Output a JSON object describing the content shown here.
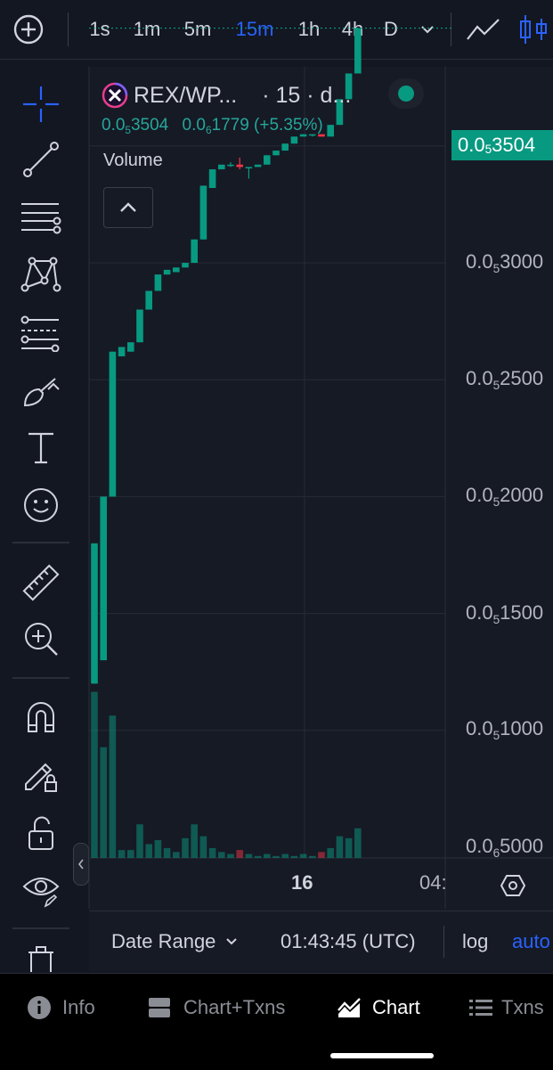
{
  "topbar": {
    "intervals": [
      "1s",
      "1m",
      "5m",
      "15m",
      "1h",
      "4h",
      "D"
    ],
    "active_interval": "15m",
    "active_color": "#2962ff"
  },
  "legend": {
    "symbol": "REX/WP...",
    "resolution": "· 15 · d...",
    "status_color": "#089981",
    "ohlc_values": [
      {
        "lead": "0.0",
        "sub": "5",
        "rest": "3504"
      },
      {
        "lead": "0.0",
        "sub": "6",
        "rest": "1779 (+5.35%)"
      }
    ],
    "volume_label": "Volume"
  },
  "chart_data": {
    "type": "candlestick",
    "interval": "15m",
    "price_axis_ticks": [
      {
        "lead": "0.0",
        "sub": "5",
        "rest": "3000"
      },
      {
        "lead": "0.0",
        "sub": "5",
        "rest": "2500"
      },
      {
        "lead": "0.0",
        "sub": "5",
        "rest": "2000"
      },
      {
        "lead": "0.0",
        "sub": "5",
        "rest": "1500"
      },
      {
        "lead": "0.0",
        "sub": "5",
        "rest": "1000"
      },
      {
        "lead": "0.0",
        "sub": "6",
        "rest": "5000"
      }
    ],
    "last_price": {
      "lead": "0.0",
      "sub": "5",
      "rest": "3504"
    },
    "time_axis_ticks": [
      "16",
      "04:"
    ],
    "up_color": "#089981",
    "down_color": "#f23645",
    "candles_units": "price ×1e-6",
    "candles": [
      {
        "o": 0.7,
        "h": 1.3,
        "l": 0.7,
        "c": 1.3
      },
      {
        "o": 0.8,
        "h": 1.5,
        "l": 0.8,
        "c": 1.5
      },
      {
        "o": 1.5,
        "h": 2.12,
        "l": 1.5,
        "c": 2.12
      },
      {
        "o": 2.1,
        "h": 2.14,
        "l": 2.1,
        "c": 2.14
      },
      {
        "o": 2.12,
        "h": 2.16,
        "l": 2.12,
        "c": 2.16
      },
      {
        "o": 2.16,
        "h": 2.3,
        "l": 2.16,
        "c": 2.3
      },
      {
        "o": 2.3,
        "h": 2.38,
        "l": 2.3,
        "c": 2.38
      },
      {
        "o": 2.38,
        "h": 2.45,
        "l": 2.38,
        "c": 2.45
      },
      {
        "o": 2.45,
        "h": 2.47,
        "l": 2.45,
        "c": 2.47
      },
      {
        "o": 2.46,
        "h": 2.48,
        "l": 2.46,
        "c": 2.48
      },
      {
        "o": 2.48,
        "h": 2.5,
        "l": 2.48,
        "c": 2.5
      },
      {
        "o": 2.5,
        "h": 2.6,
        "l": 2.5,
        "c": 2.6
      },
      {
        "o": 2.6,
        "h": 2.83,
        "l": 2.6,
        "c": 2.83
      },
      {
        "o": 2.82,
        "h": 2.9,
        "l": 2.82,
        "c": 2.9
      },
      {
        "o": 2.9,
        "h": 2.92,
        "l": 2.9,
        "c": 2.92
      },
      {
        "o": 2.92,
        "h": 2.93,
        "l": 2.91,
        "c": 2.92
      },
      {
        "o": 2.92,
        "h": 2.95,
        "l": 2.9,
        "c": 2.91
      },
      {
        "o": 2.91,
        "h": 2.91,
        "l": 2.86,
        "c": 2.91
      },
      {
        "o": 2.91,
        "h": 2.92,
        "l": 2.91,
        "c": 2.92
      },
      {
        "o": 2.92,
        "h": 2.96,
        "l": 2.92,
        "c": 2.96
      },
      {
        "o": 2.96,
        "h": 2.98,
        "l": 2.96,
        "c": 2.98
      },
      {
        "o": 2.98,
        "h": 3.01,
        "l": 2.98,
        "c": 3.01
      },
      {
        "o": 3.01,
        "h": 3.04,
        "l": 3.01,
        "c": 3.04
      },
      {
        "o": 3.04,
        "h": 3.05,
        "l": 3.04,
        "c": 3.05
      },
      {
        "o": 3.05,
        "h": 3.05,
        "l": 3.04,
        "c": 3.05
      },
      {
        "o": 3.05,
        "h": 3.05,
        "l": 3.04,
        "c": 3.04
      },
      {
        "o": 3.04,
        "h": 3.09,
        "l": 3.04,
        "c": 3.09
      },
      {
        "o": 3.09,
        "h": 3.2,
        "l": 3.09,
        "c": 3.2
      },
      {
        "o": 3.2,
        "h": 3.31,
        "l": 3.2,
        "c": 3.31
      },
      {
        "o": 3.31,
        "h": 3.504,
        "l": 3.31,
        "c": 3.504
      }
    ],
    "volume_units": "relative height of tallest bar = 1",
    "volumes": [
      0.84,
      0.56,
      0.72,
      0.04,
      0.04,
      0.17,
      0.07,
      0.09,
      0.05,
      0.03,
      0.1,
      0.17,
      0.11,
      0.05,
      0.03,
      0.02,
      0.04,
      0.02,
      0.01,
      0.02,
      0.01,
      0.02,
      0.01,
      0.02,
      0.01,
      0.03,
      0.05,
      0.11,
      0.1,
      0.15
    ]
  },
  "bottom_bar": {
    "date_range": "Date Range",
    "time": "01:43:45 (UTC)",
    "log": "log",
    "auto": "auto",
    "auto_color": "#2962ff"
  },
  "nav": [
    {
      "label": "Info",
      "icon": "info-icon",
      "active": false
    },
    {
      "label": "Chart+Txns",
      "icon": "chart-txns-icon",
      "active": false
    },
    {
      "label": "Chart",
      "icon": "chart-icon",
      "active": true
    },
    {
      "label": "Txns",
      "icon": "list-icon",
      "active": false
    }
  ]
}
